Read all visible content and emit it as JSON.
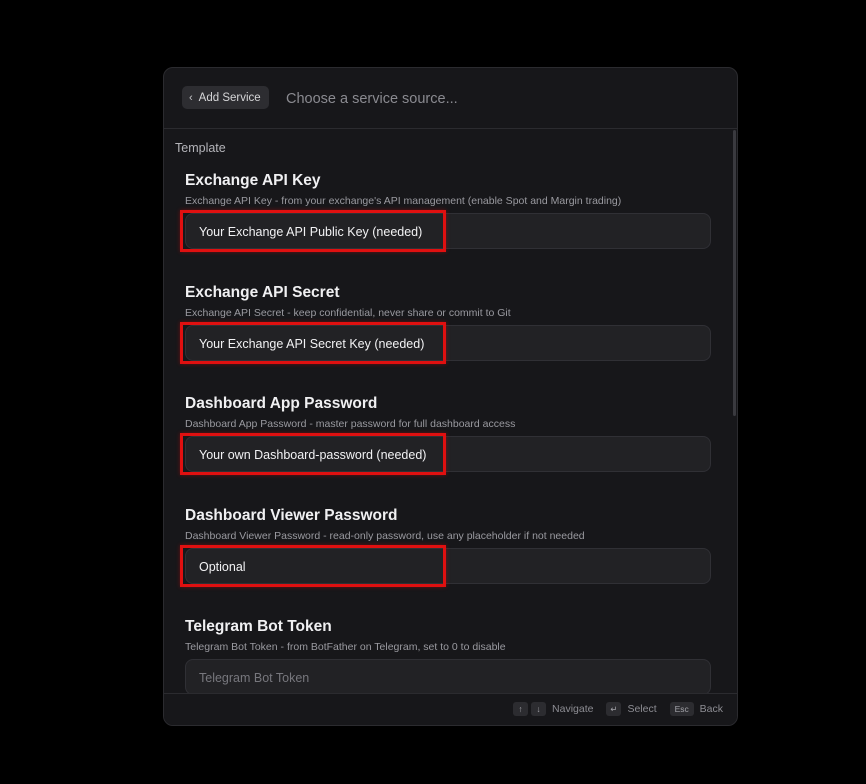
{
  "header": {
    "back_label": "Add Service",
    "search_placeholder": "Choose a service source..."
  },
  "section_label": "Template",
  "fields": [
    {
      "title": "Exchange API Key",
      "description": "Exchange API Key - from your exchange's API management (enable Spot and Margin trading)",
      "value": "Your Exchange API Public Key (needed)",
      "placeholder": ""
    },
    {
      "title": "Exchange API Secret",
      "description": "Exchange API Secret - keep confidential, never share or commit to Git",
      "value": "Your Exchange API Secret Key (needed)",
      "placeholder": ""
    },
    {
      "title": "Dashboard App Password",
      "description": "Dashboard App Password - master password for full dashboard access",
      "value": "Your own Dashboard-password (needed)",
      "placeholder": ""
    },
    {
      "title": "Dashboard Viewer Password",
      "description": "Dashboard Viewer Password - read-only password, use any placeholder if not needed",
      "value": "Optional",
      "placeholder": ""
    },
    {
      "title": "Telegram Bot Token",
      "description": "Telegram Bot Token - from BotFather on Telegram, set to 0 to disable",
      "value": "",
      "placeholder": "Telegram Bot Token"
    }
  ],
  "footer": {
    "up_key": "↑",
    "down_key": "↓",
    "navigate_label": "Navigate",
    "enter_key": "↵",
    "select_label": "Select",
    "esc_key": "Esc",
    "back_label": "Back"
  },
  "colors": {
    "highlight": "#e01010",
    "modal_bg": "#17171a",
    "input_bg": "#222225"
  }
}
